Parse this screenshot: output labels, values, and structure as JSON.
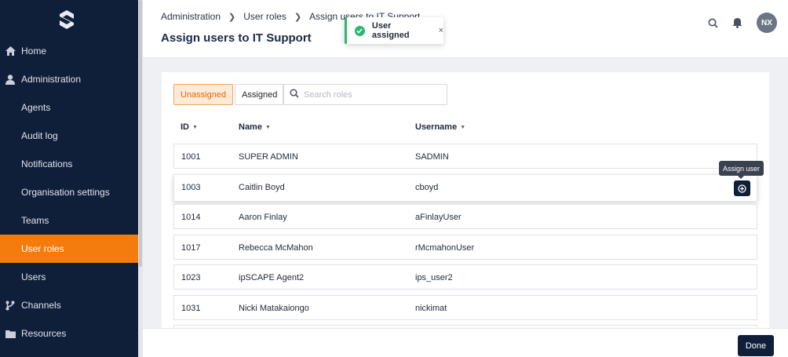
{
  "sidebar": {
    "items": [
      {
        "label": "Home",
        "icon": "home-icon"
      },
      {
        "label": "Administration",
        "icon": "user-icon"
      },
      {
        "label": "Agents"
      },
      {
        "label": "Audit log"
      },
      {
        "label": "Notifications"
      },
      {
        "label": "Organisation settings"
      },
      {
        "label": "Teams"
      },
      {
        "label": "User roles",
        "active": true
      },
      {
        "label": "Users"
      },
      {
        "label": "Channels",
        "icon": "branch-icon"
      },
      {
        "label": "Resources",
        "icon": "folder-icon"
      }
    ]
  },
  "header": {
    "breadcrumb": [
      "Administration",
      "User roles",
      "Assign users to IT Support"
    ],
    "title": "Assign users to IT Support",
    "avatar_initials": "NX"
  },
  "toast": {
    "message": "User assigned",
    "close": "×"
  },
  "tabs": {
    "unassigned": "Unassigned",
    "assigned": "Assigned"
  },
  "search": {
    "placeholder": "Search roles"
  },
  "table": {
    "columns": [
      "ID",
      "Name",
      "Username"
    ],
    "rows": [
      {
        "id": "1001",
        "name": "SUPER ADMIN",
        "username": "SADMIN"
      },
      {
        "id": "1003",
        "name": "Caitlin Boyd",
        "username": "cboyd"
      },
      {
        "id": "1014",
        "name": "Aaron Finlay",
        "username": "aFinlayUser"
      },
      {
        "id": "1017",
        "name": "Rebecca McMahon",
        "username": "rMcmahonUser"
      },
      {
        "id": "1023",
        "name": "ipSCAPE Agent2",
        "username": "ips_user2"
      },
      {
        "id": "1031",
        "name": "Nicki Matakaiongo",
        "username": "nickimat"
      }
    ]
  },
  "tooltip": "Assign user",
  "footer": {
    "done_label": "Done"
  },
  "colors": {
    "sidebar_bg": "#0f1f3a",
    "accent": "#f47c0f",
    "success": "#2bb673"
  }
}
